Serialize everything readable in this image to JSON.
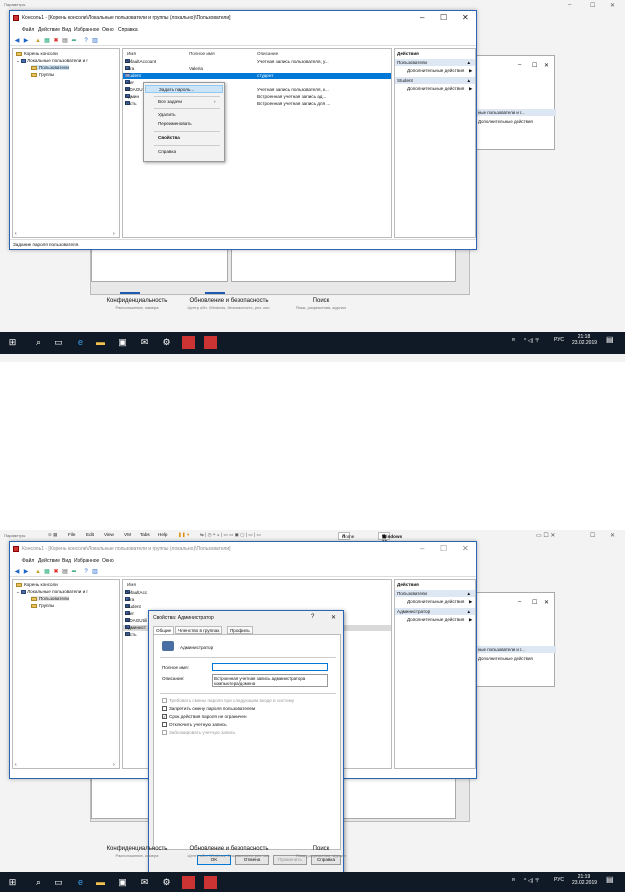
{
  "screen1": {
    "params": {
      "title": "Параметры",
      "settings": [
        {
          "title": "Конфиденциальность",
          "desc": "Расположение, камера"
        },
        {
          "title": "Обновление и безопасность",
          "desc": "Центр обн. Windows, безопасность, рез. коп."
        },
        {
          "title": "Поиск",
          "desc": "Язык, разрешения, журнал"
        }
      ]
    },
    "mmc": {
      "title": "Консоль1 - [Корень консоли\\Локальные пользователи и группы (локально)\\Пользователи]",
      "menu": [
        "Файл",
        "Действие",
        "Вид",
        "Избранное",
        "Окно",
        "Справка"
      ],
      "tree": [
        "Корень консоли",
        "Локальные пользователи и г",
        "Пользователи",
        "Группы"
      ],
      "columns": [
        "Имя",
        "Полное имя",
        "Описание"
      ],
      "rows": [
        {
          "name": "DefaultAccount",
          "full": "",
          "desc": "Учетная запись пользователя, у..."
        },
        {
          "name": "Lera",
          "full": "Valeria",
          "desc": ""
        },
        {
          "name": "Student",
          "full": "",
          "desc": "студент"
        },
        {
          "name": "user",
          "full": "",
          "desc": ""
        },
        {
          "name": "WDAGU",
          "full": "",
          "desc": "Учетная запись пользователя, к..."
        },
        {
          "name": "Админ",
          "full": "",
          "desc": "Встроенная учетная запись ад..."
        },
        {
          "name": "Гость",
          "full": "",
          "desc": "Встроенная учетная запись для ..."
        }
      ],
      "actions": {
        "header": "Действия",
        "group1": "Пользователи",
        "item1": "Дополнительные действия",
        "group2": "Student",
        "item2": "Дополнительные действия"
      },
      "context_menu": [
        "Задать пароль...",
        "Все задачи",
        "Удалить",
        "Переименовать",
        "Свойства",
        "Справка"
      ],
      "status": "Задание пароля пользователя."
    },
    "bg_actions": {
      "group": "ные пользователи и г...",
      "item": "Дополнительные действия"
    },
    "taskbar": {
      "lang": "РУС",
      "time": "21:18",
      "date": "23.02.2019"
    }
  },
  "screen2": {
    "params_title": "Параметры",
    "vbox_menu": [
      "File",
      "Edit",
      "View",
      "VM",
      "Tabs",
      "Help"
    ],
    "tabs": {
      "home": "Home",
      "vm": "Windows 10"
    },
    "mmc": {
      "title": "Консоль1 - [Корень консоли\\Локальные пользователи и группы (локально)\\Пользователи]",
      "menu": [
        "Файл",
        "Действие",
        "Вид",
        "Избранное",
        "Окно"
      ],
      "tree": [
        "Корень консоли",
        "Локальные пользователи и г",
        "Пользователи",
        "Группы"
      ],
      "column": "Имя",
      "rows": [
        "DefaultAcc",
        "Lera",
        "Student",
        "user",
        "WDAGUtili",
        "Админист",
        "Гость"
      ],
      "actions": {
        "header": "Действия",
        "group1": "Пользователи",
        "item1": "Дополнительные действия",
        "group2": "Администратор",
        "item2": "Дополнительные действия"
      }
    },
    "dialog": {
      "title": "Свойства: Администратор",
      "help": "?",
      "tabs": [
        "Общие",
        "Членство в группах",
        "Профиль"
      ],
      "username": "Администратор",
      "fullname_label": "Полное имя:",
      "fullname_value": "",
      "desc_label": "Описание:",
      "desc_value": "Встроенная учетная запись администратора компьютера/домена",
      "checks": [
        {
          "label": "Требовать смены пароля при следующем входе в систему",
          "checked": false,
          "disabled": true
        },
        {
          "label": "Запретить смену пароля пользователем",
          "checked": false,
          "disabled": false
        },
        {
          "label": "Срок действия пароля не ограничен",
          "checked": true,
          "disabled": false
        },
        {
          "label": "Отключить учетную запись",
          "checked": false,
          "disabled": false
        },
        {
          "label": "Заблокировать учетную запись",
          "checked": false,
          "disabled": true
        }
      ],
      "buttons": {
        "ok": "OK",
        "cancel": "Отмена",
        "apply": "Применить",
        "help": "Справка"
      }
    },
    "bg_actions": {
      "group": "ные пользователи и г...",
      "item": "Дополнительные действия"
    },
    "params": {
      "settings": [
        {
          "title": "Конфиденциальность",
          "desc": "Расположение, камера"
        },
        {
          "title": "Обновление и безопасность",
          "desc": "Центр обн. Windows, безопасность, рез. коп."
        },
        {
          "title": "Поиск",
          "desc": "Язык, разрешения, журнал"
        }
      ]
    },
    "taskbar": {
      "lang": "РУС",
      "time": "21:19",
      "date": "23.02.2019"
    }
  }
}
